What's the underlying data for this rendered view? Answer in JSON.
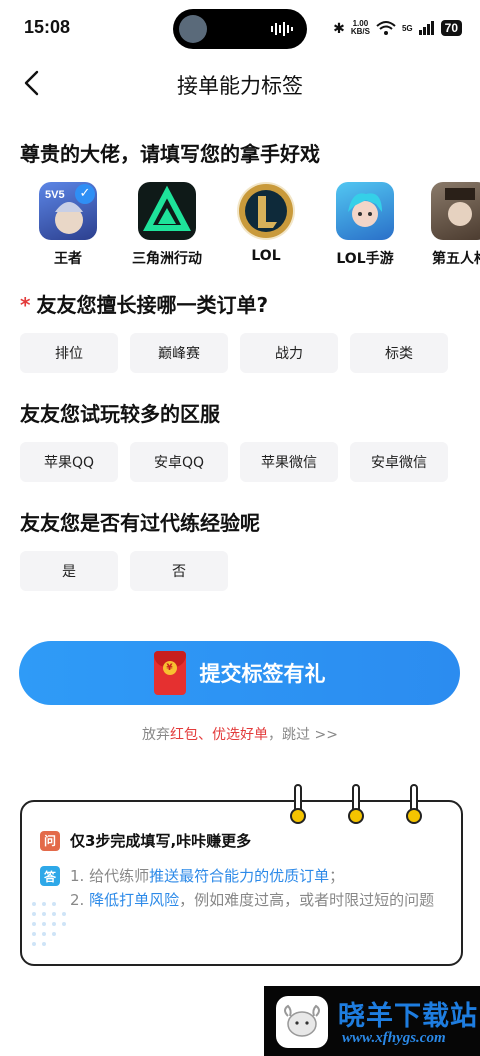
{
  "status_bar": {
    "time": "15:08",
    "network_speed": "1.00",
    "network_unit": "KB/S",
    "signal_label": "5G",
    "battery": "70"
  },
  "header": {
    "title": "接单能力标签"
  },
  "games_section": {
    "title": "尊贵的大佬，请填写您的拿手好戏",
    "games": [
      {
        "name": "王者",
        "selected": true,
        "icon": "honor-of-kings-icon",
        "color": "#4a6fd0"
      },
      {
        "name": "三角洲行动",
        "selected": false,
        "icon": "delta-force-icon",
        "color": "#0f1a18"
      },
      {
        "name": "LOL",
        "selected": false,
        "icon": "lol-icon",
        "color": "#0e2a3a"
      },
      {
        "name": "LOL手游",
        "selected": false,
        "icon": "wild-rift-icon",
        "color": "#3ab0e8"
      },
      {
        "name": "第五人格",
        "selected": false,
        "icon": "identity-v-icon",
        "color": "#6b5b4b"
      }
    ]
  },
  "order_type_section": {
    "required_mark": "*",
    "title": "友友您擅长接哪一类订单?",
    "options": [
      "排位",
      "巅峰赛",
      "战力",
      "标类"
    ]
  },
  "server_section": {
    "title": "友友您试玩较多的区服",
    "options": [
      "苹果QQ",
      "安卓QQ",
      "苹果微信",
      "安卓微信"
    ]
  },
  "experience_section": {
    "title": "友友您是否有过代练经验呢",
    "options": [
      "是",
      "否"
    ]
  },
  "submit": {
    "label": "提交标签有礼",
    "envelope_symbol": "¥"
  },
  "skip": {
    "prefix": "放弃",
    "highlight": "红包、优选好单",
    "suffix": "，跳过 >>"
  },
  "note_card": {
    "q_badge": "问",
    "question": "仅3步完成填写,咔咔赚更多",
    "a_badge": "答",
    "line1_prefix": "1. 给代练师",
    "line1_highlight": "推送最符合能力的优质订单",
    "line1_suffix": "；",
    "line2_prefix": "2. ",
    "line2_highlight": "降低打单风险",
    "line2_suffix": "，例如难度过高，或者时限过短的问题"
  },
  "watermark": {
    "title": "晓羊下载站",
    "url": "www.xfhygs.com"
  },
  "colors": {
    "accent_blue": "#2f9bf7",
    "required_red": "#e33b3b",
    "chip_bg": "#f4f4f6"
  }
}
